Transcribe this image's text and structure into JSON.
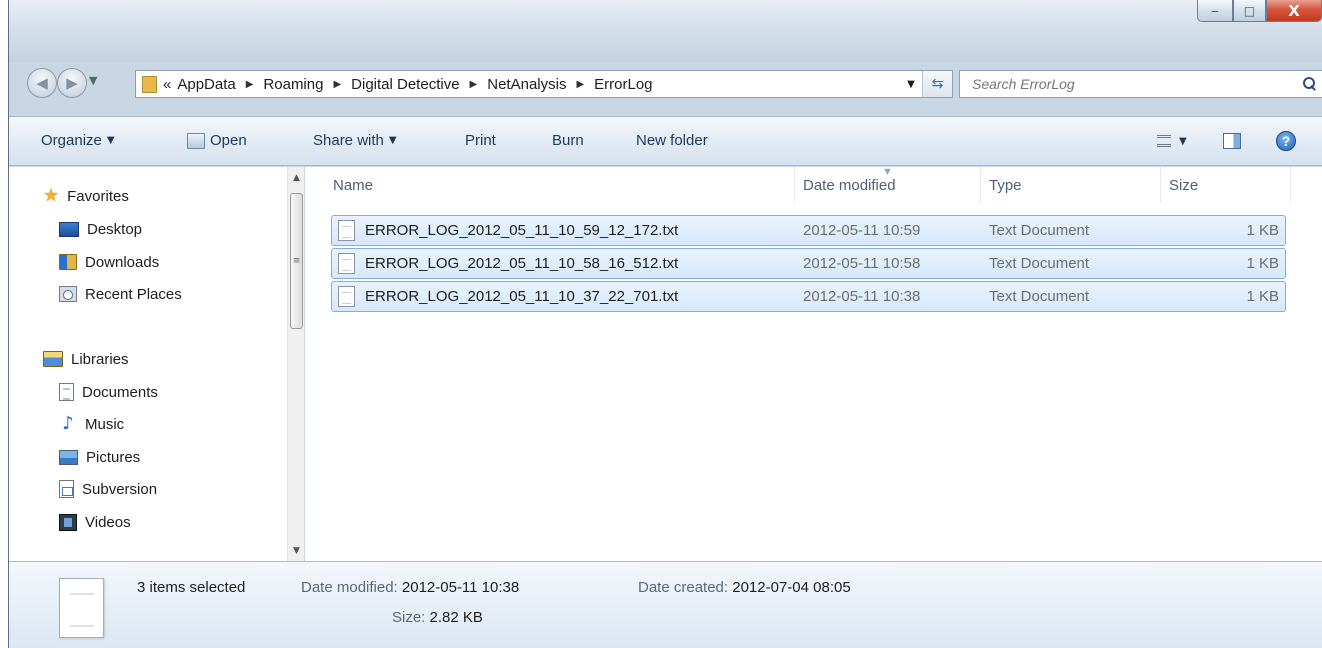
{
  "window": {
    "controls": {
      "minimize": "‒",
      "maximize": "□",
      "close": "X"
    }
  },
  "address": {
    "overflow": "«",
    "crumbs": [
      "AppData",
      "Roaming",
      "Digital Detective",
      "NetAnalysis",
      "ErrorLog"
    ],
    "separator": "▶"
  },
  "search": {
    "placeholder": "Search ErrorLog"
  },
  "toolbar": {
    "organize": "Organize",
    "open": "Open",
    "share_with": "Share with",
    "print": "Print",
    "burn": "Burn",
    "new_folder": "New folder"
  },
  "nav": {
    "favorites": "Favorites",
    "desktop": "Desktop",
    "downloads": "Downloads",
    "recent_places": "Recent Places",
    "libraries": "Libraries",
    "documents": "Documents",
    "music": "Music",
    "pictures": "Pictures",
    "subversion": "Subversion",
    "videos": "Videos"
  },
  "columns": {
    "name": "Name",
    "date_modified": "Date modified",
    "type": "Type",
    "size": "Size"
  },
  "files": [
    {
      "name": "ERROR_LOG_2012_05_11_10_59_12_172.txt",
      "date": "2012-05-11 10:59",
      "type": "Text Document",
      "size": "1 KB"
    },
    {
      "name": "ERROR_LOG_2012_05_11_10_58_16_512.txt",
      "date": "2012-05-11 10:58",
      "type": "Text Document",
      "size": "1 KB"
    },
    {
      "name": "ERROR_LOG_2012_05_11_10_37_22_701.txt",
      "date": "2012-05-11 10:38",
      "type": "Text Document",
      "size": "1 KB"
    }
  ],
  "details": {
    "selection": "3 items selected",
    "date_modified_label": "Date modified:",
    "date_modified": "2012-05-11 10:38",
    "date_created_label": "Date created:",
    "date_created": "2012-07-04 08:05",
    "size_label": "Size:",
    "size": "2.82 KB"
  },
  "colors": {
    "selection_fill": "#d7e8fb",
    "selection_border": "#84acdd",
    "link_text": "#1e395b"
  }
}
